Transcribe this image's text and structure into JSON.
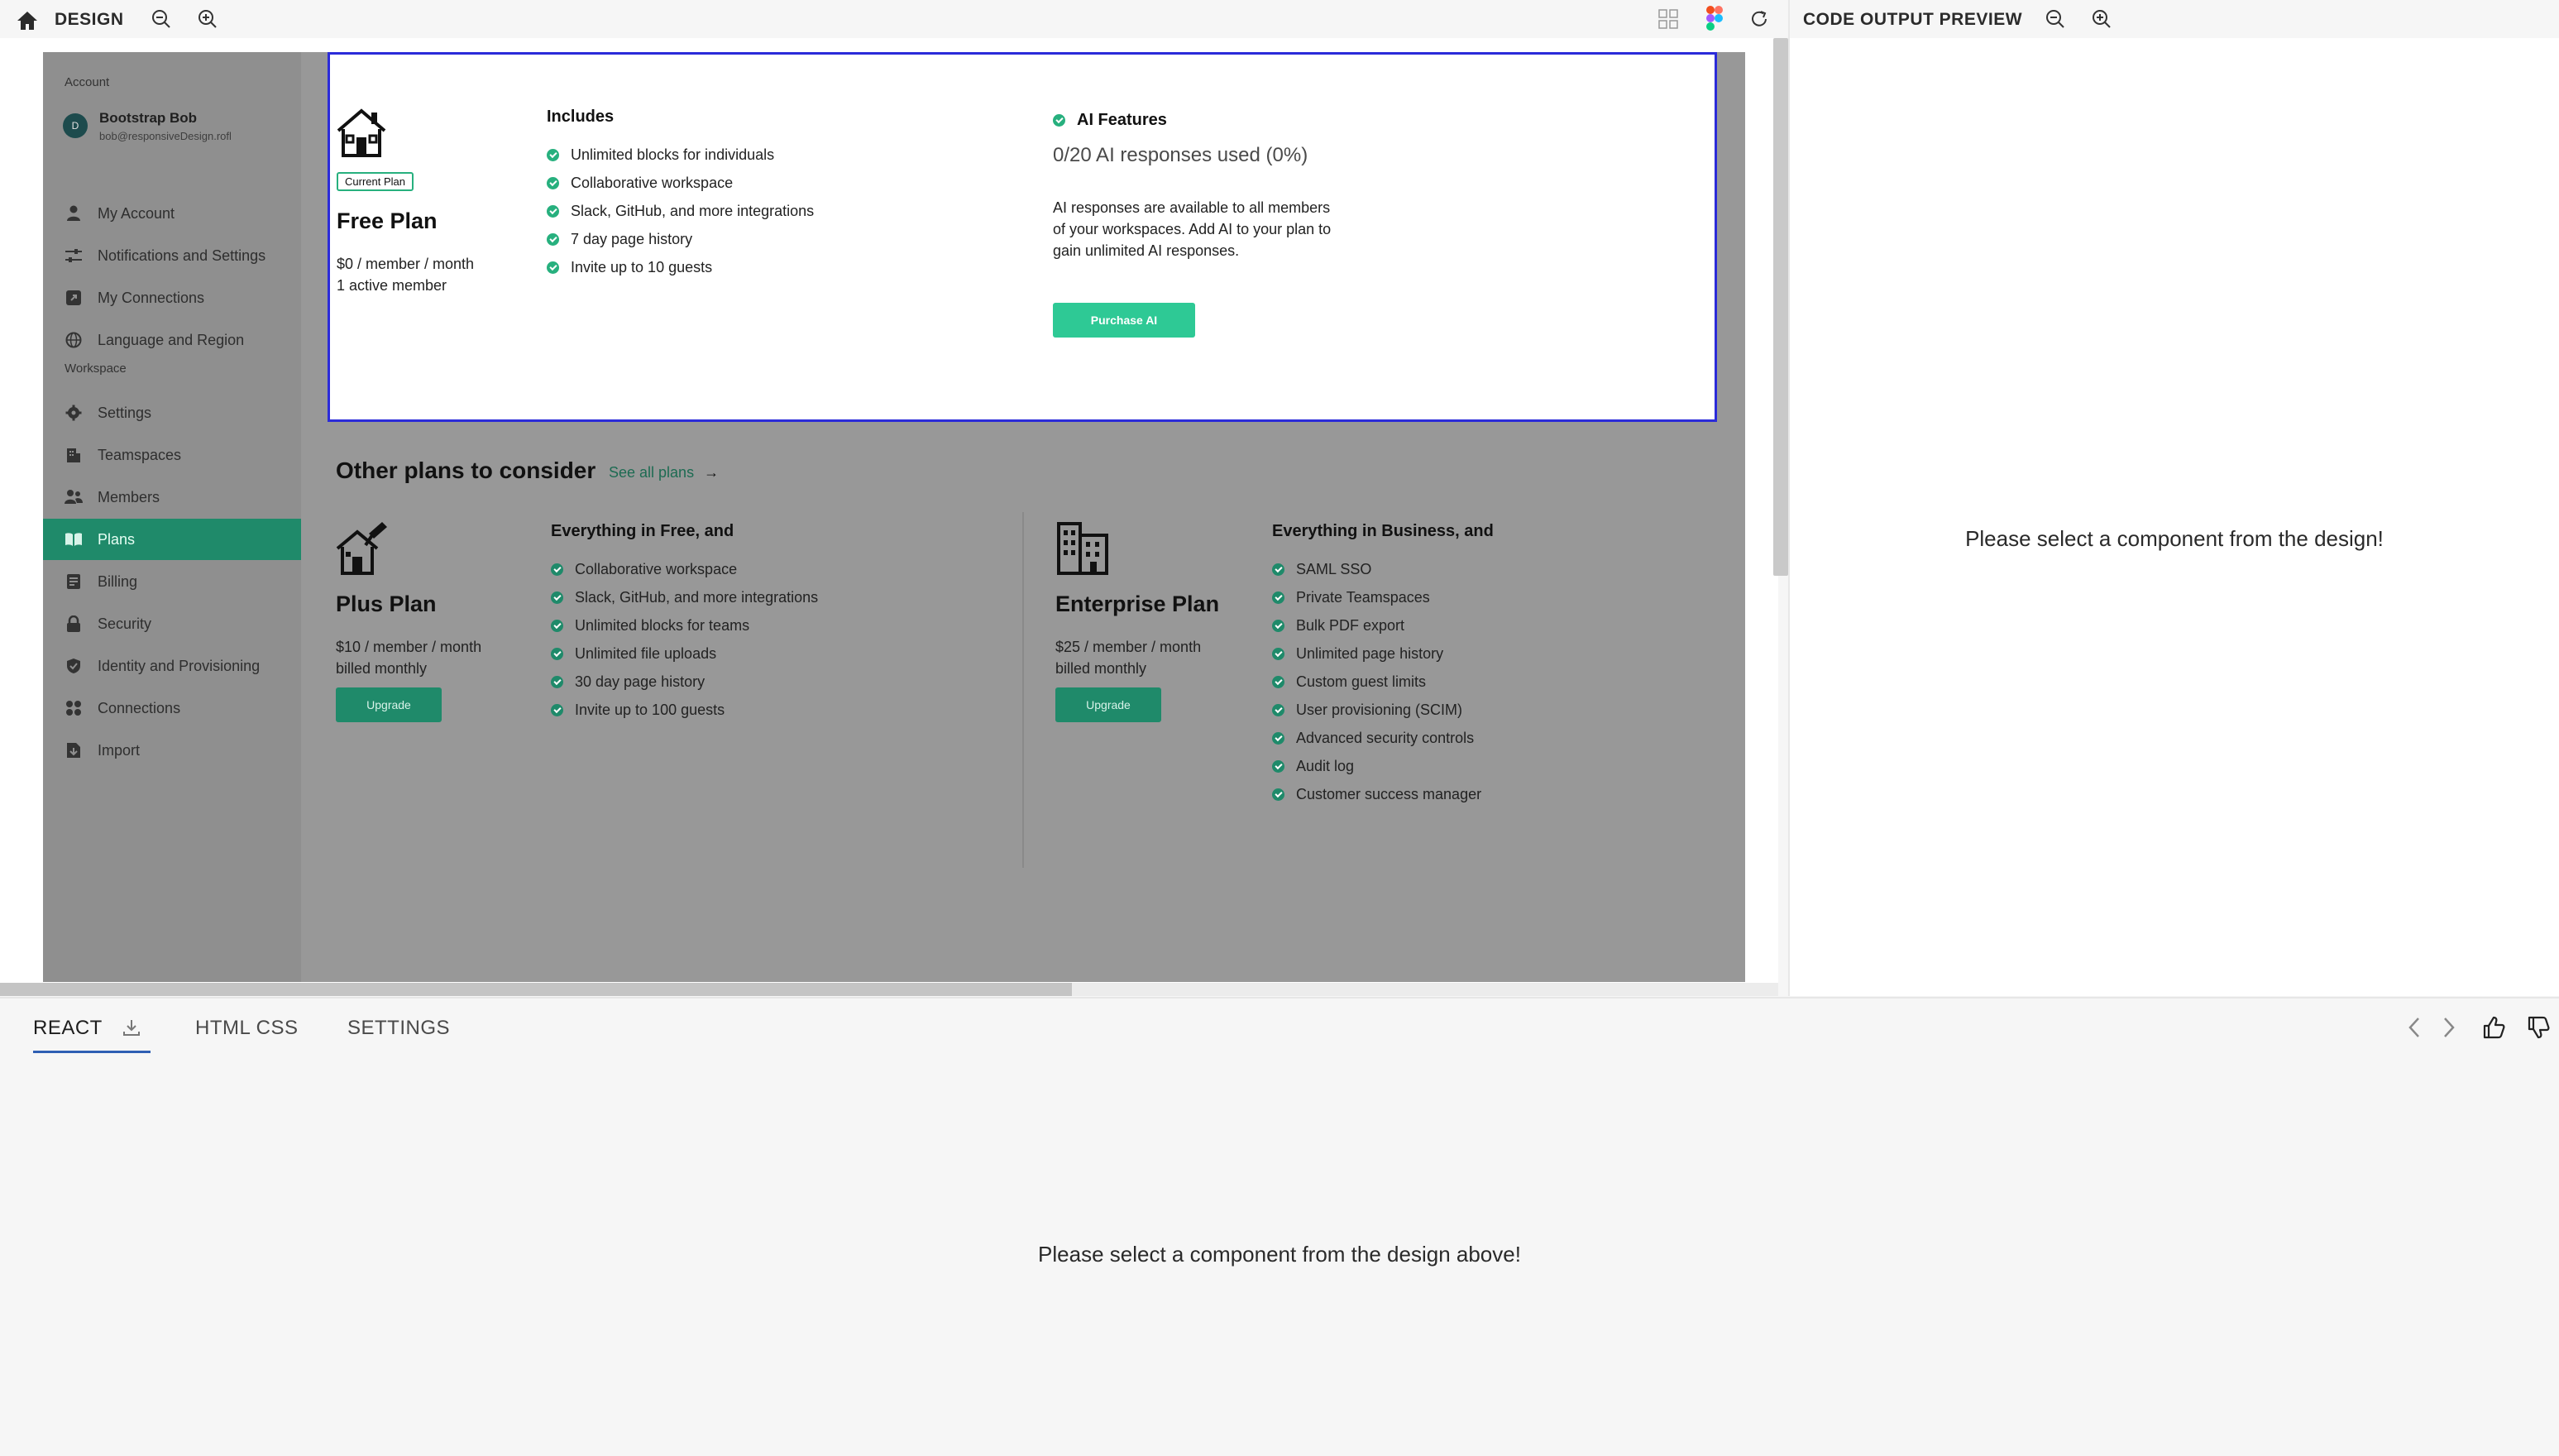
{
  "toolbar": {
    "design_label": "DESIGN",
    "preview_label": "CODE OUTPUT PREVIEW"
  },
  "sidebar": {
    "account_section": "Account",
    "user": {
      "initial": "D",
      "name": "Bootstrap Bob",
      "email": "bob@responsiveDesign.rofl"
    },
    "account_items": [
      {
        "label": "My Account",
        "icon": "user-icon"
      },
      {
        "label": "Notifications and Settings",
        "icon": "sliders-icon"
      },
      {
        "label": "My Connections",
        "icon": "external-link-icon"
      },
      {
        "label": "Language and Region",
        "icon": "globe-icon"
      }
    ],
    "workspace_section": "Workspace",
    "workspace_items": [
      {
        "label": "Settings",
        "icon": "gear-icon"
      },
      {
        "label": "Teamspaces",
        "icon": "building-icon"
      },
      {
        "label": "Members",
        "icon": "members-icon"
      },
      {
        "label": "Plans",
        "icon": "book-icon",
        "active": true
      },
      {
        "label": "Billing",
        "icon": "billing-icon"
      },
      {
        "label": "Security",
        "icon": "lock-icon"
      },
      {
        "label": "Identity and Provisioning",
        "icon": "shield-icon"
      },
      {
        "label": "Connections",
        "icon": "grid-icon"
      },
      {
        "label": "Import",
        "icon": "import-icon"
      }
    ]
  },
  "current_plan": {
    "badge": "Current Plan",
    "name": "Free Plan",
    "price": "$0 / member / month",
    "members": "1 active member",
    "includes_title": "Includes",
    "features": [
      "Unlimited blocks for individuals",
      "Collaborative workspace",
      "Slack, GitHub, and more integrations",
      "7 day page history",
      "Invite up to 10 guests"
    ],
    "ai": {
      "title": "AI Features",
      "usage": "0/20 AI responses used (0%)",
      "description_lines": [
        "AI responses are available to all members",
        "of your workspaces. Add AI to your plan to",
        "gain unlimited AI responses."
      ],
      "button": "Purchase AI"
    }
  },
  "other_plans": {
    "title": "Other plans to consider",
    "see_all": "See all plans",
    "plus": {
      "name": "Plus Plan",
      "price": "$10 / member / month",
      "billing": "billed monthly",
      "button": "Upgrade",
      "features_title": "Everything in Free, and",
      "features": [
        "Collaborative workspace",
        "Slack, GitHub, and more integrations",
        "Unlimited blocks for teams",
        "Unlimited file uploads",
        "30 day page history",
        "Invite up to 100 guests"
      ]
    },
    "enterprise": {
      "name": "Enterprise Plan",
      "price": "$25 / member / month",
      "billing": "billed monthly",
      "button": "Upgrade",
      "features_title": "Everything in Business, and",
      "features": [
        "SAML SSO",
        "Private Teamspaces",
        "Bulk PDF export",
        "Unlimited page history",
        "Custom guest limits",
        "User provisioning (SCIM)",
        "Advanced security controls",
        "Audit log",
        "Customer success manager"
      ]
    }
  },
  "preview": {
    "message": "Please select a component from the design!"
  },
  "bottom": {
    "tabs": [
      "REACT",
      "HTML CSS",
      "SETTINGS"
    ],
    "active_tab": "REACT",
    "message": "Please select a component from the design above!"
  },
  "colors": {
    "accent_green": "#1f8a6a",
    "check_green": "#27b07e",
    "selection_blue": "#2b2bd9"
  }
}
